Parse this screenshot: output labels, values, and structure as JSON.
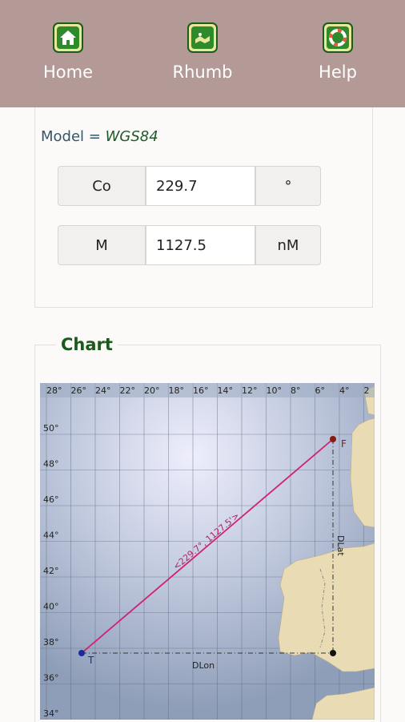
{
  "nav": {
    "items": [
      {
        "label": "Home",
        "icon": "home-icon"
      },
      {
        "label": "Rhumb",
        "icon": "rhumb-map-icon"
      },
      {
        "label": "Help",
        "icon": "lifebuoy-icon"
      }
    ]
  },
  "model": {
    "prefix": "Model =",
    "value": "WGS84"
  },
  "fields": {
    "course": {
      "label": "Co",
      "value": "229.7",
      "unit": "°"
    },
    "distance": {
      "label": "M",
      "value": "1127.5",
      "unit": "nM"
    }
  },
  "chart_section": {
    "legend": "Chart"
  },
  "chart_data": {
    "type": "map",
    "x_ticks": [
      "28°",
      "26°",
      "24°",
      "22°",
      "20°",
      "18°",
      "16°",
      "14°",
      "12°",
      "10°",
      "8°",
      "6°",
      "4°",
      "2"
    ],
    "y_ticks": [
      "50°",
      "48°",
      "46°",
      "44°",
      "42°",
      "40°",
      "38°",
      "36°",
      "34°"
    ],
    "from_label": "F",
    "to_label": "T",
    "track_label": "<229.7°, 1127.5'>",
    "dlon_label": "DLon",
    "dlat_label": "DLat",
    "colors": {
      "track": "#d0207a",
      "guide": "#333333",
      "land": "#e8dcb8",
      "sea": "#a8b6cc"
    }
  }
}
